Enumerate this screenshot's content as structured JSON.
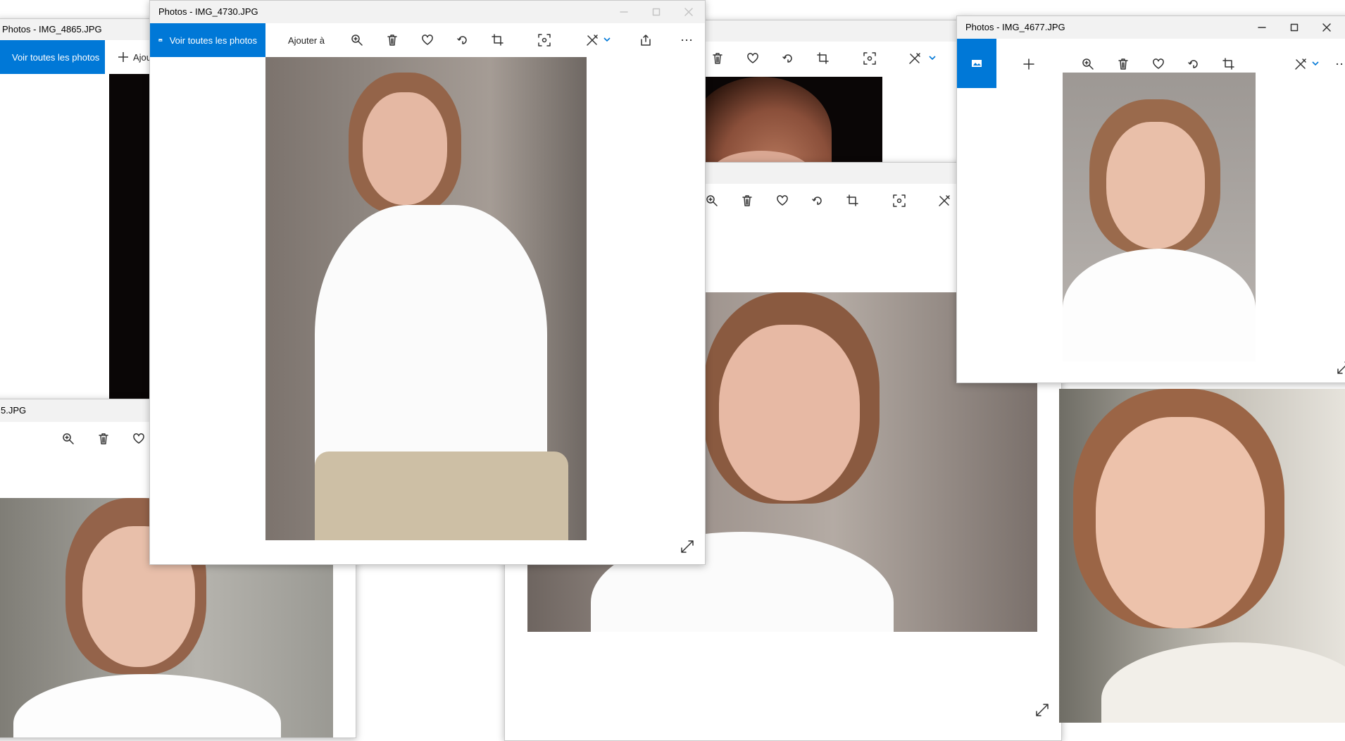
{
  "windows": {
    "w4865": {
      "title": "Photos - IMG_4865.JPG",
      "view_all": "Voir toutes les photos",
      "add_to": "Ajou"
    },
    "w4730": {
      "title": "Photos - IMG_4730.JPG",
      "view_all": "Voir toutes les photos",
      "add_to": "Ajouter à"
    },
    "w4677": {
      "title": "Photos - IMG_4677.JPG"
    },
    "wbottom": {
      "title": "5.JPG"
    }
  },
  "icons": [
    "photos-icon",
    "plus-icon",
    "zoom-in-icon",
    "delete-icon",
    "heart-icon",
    "rotate-icon",
    "crop-icon",
    "visual-search-icon",
    "edit-icon",
    "share-icon",
    "more-icon",
    "expand-icon",
    "minimize-icon",
    "maximize-icon",
    "close-icon"
  ],
  "colors": {
    "accent": "#0078d7",
    "titlebar": "#f2f2f2",
    "photo_bg": "#000000"
  }
}
